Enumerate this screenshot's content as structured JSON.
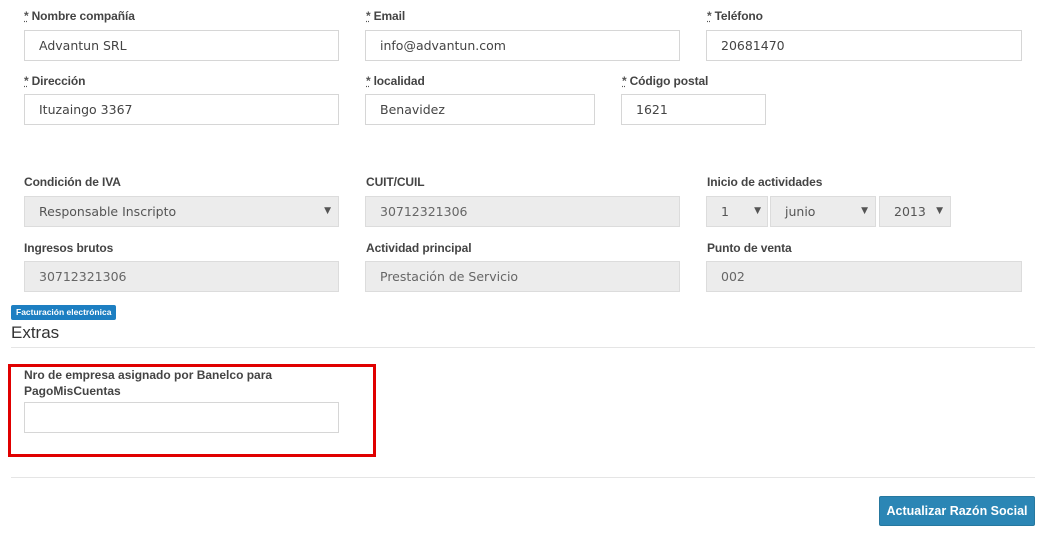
{
  "row1": {
    "nombre": {
      "label": "Nombre compañía",
      "value": "Advantun SRL"
    },
    "email": {
      "label": "Email",
      "value": "info@advantun.com"
    },
    "telefono": {
      "label": "Teléfono",
      "value": "20681470"
    }
  },
  "row2": {
    "direccion": {
      "label": "Dirección",
      "value": "Ituzaingo 3367"
    },
    "localidad": {
      "label": "localidad",
      "value": "Benavidez"
    },
    "codigo_postal": {
      "label": "Código postal",
      "value": "1621"
    }
  },
  "required_mark": "*",
  "fiscal": {
    "condicion_iva": {
      "label": "Condición de IVA",
      "value": "Responsable Inscripto"
    },
    "cuit": {
      "label": "CUIT/CUIL",
      "value": "30712321306"
    },
    "inicio": {
      "label": "Inicio de actividades",
      "day": "1",
      "month": "junio",
      "year": "2013"
    },
    "ingresos_brutos": {
      "label": "Ingresos brutos",
      "value": "30712321306"
    },
    "actividad": {
      "label": "Actividad principal",
      "value": "Prestación de Servicio"
    },
    "punto_venta": {
      "label": "Punto de venta",
      "value": "002"
    }
  },
  "badge": "Facturación electrónica",
  "extras": {
    "title": "Extras",
    "banelco_label": "Nro de empresa asignado por Banelco para PagoMisCuentas",
    "banelco_value": ""
  },
  "submit_label": "Actualizar Razón Social",
  "colors": {
    "accent": "#2b86b5",
    "highlight": "#e00000",
    "badge": "#1d7fc2"
  },
  "icons": {
    "caret": "caret-down-icon"
  }
}
